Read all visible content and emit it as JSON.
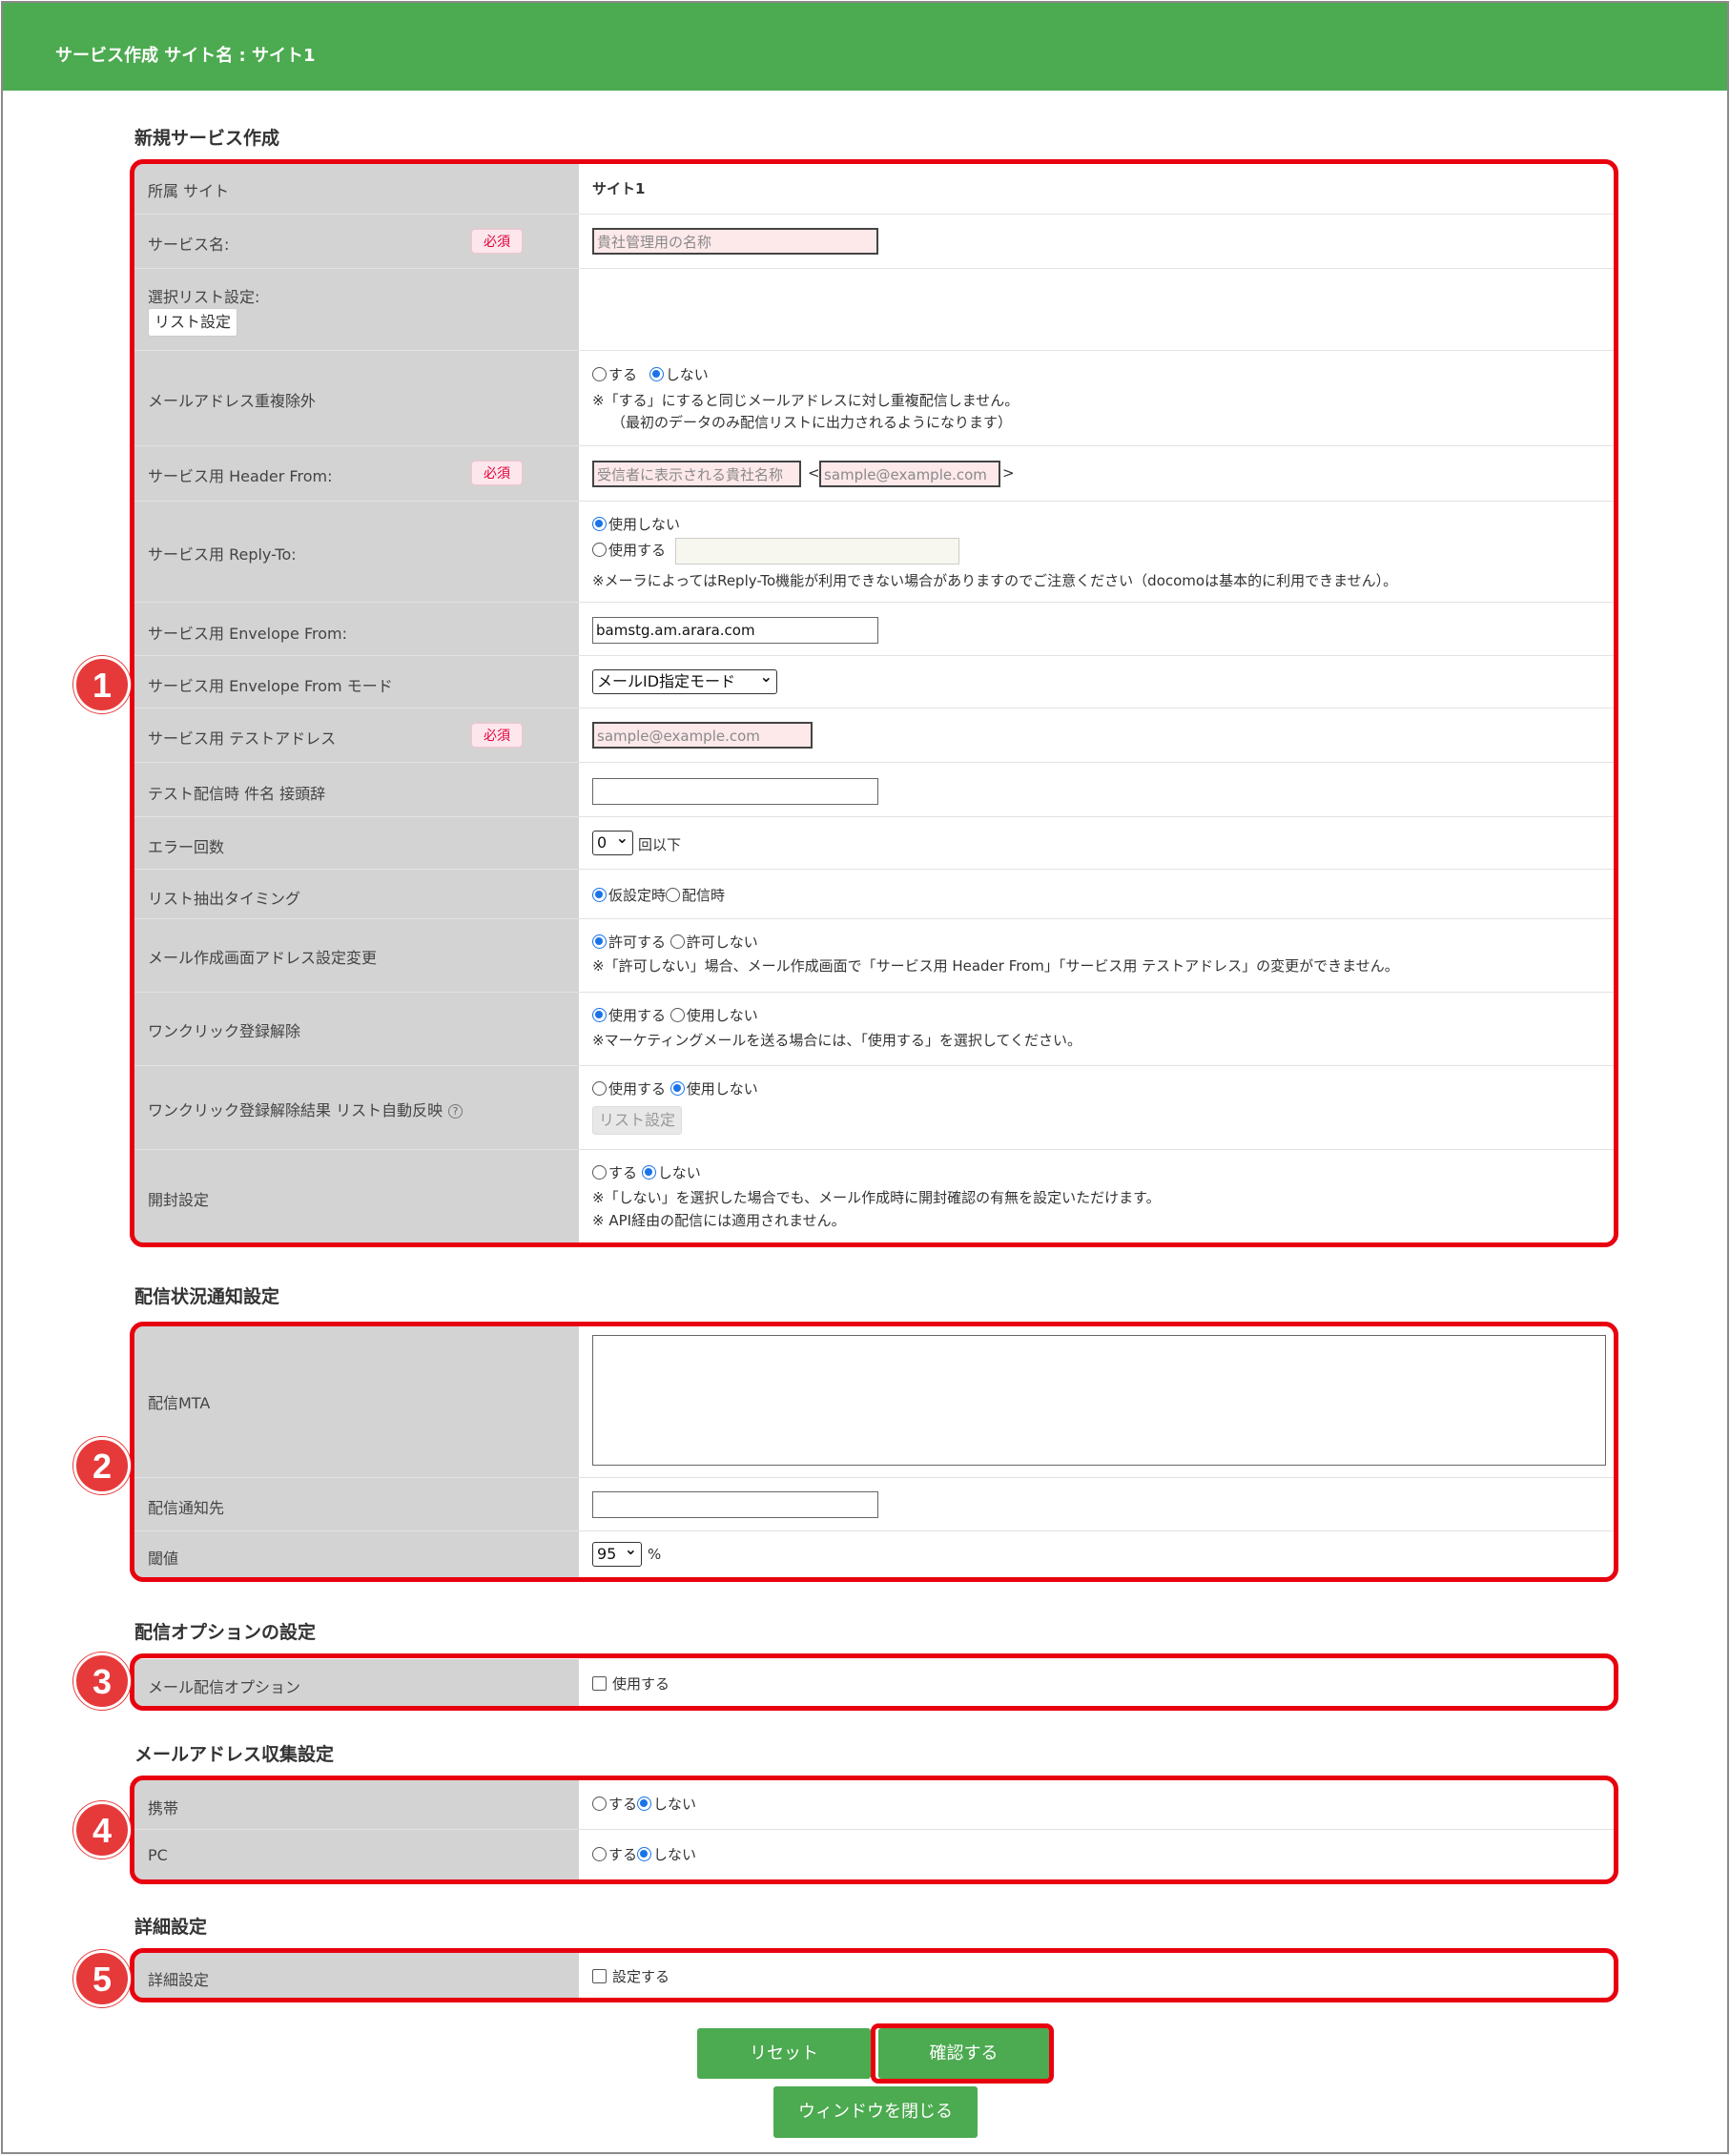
{
  "header": {
    "title": "サービス作成 サイト名 : サイト1"
  },
  "sections": {
    "new_service": "新規サービス作成",
    "delivery_notify": "配信状況通知設定",
    "delivery_option": "配信オプションの設定",
    "address_collect": "メールアドレス収集設定",
    "detail": "詳細設定"
  },
  "required_label": "必須",
  "form": {
    "site": {
      "label": "所属 サイト",
      "value": "サイト1"
    },
    "service_name": {
      "label": "サービス名:",
      "placeholder": "貴社管理用の名称"
    },
    "list_settings": {
      "label": "選択リスト設定:",
      "button": "リスト設定"
    },
    "dedupe": {
      "label": "メールアドレス重複除外",
      "opt_yes": "する",
      "opt_no": "しない",
      "selected": "しない",
      "note1": "※「する」にすると同じメールアドレスに対し重複配信しません。",
      "note2": "（最初のデータのみ配信リストに出力されるようになります）"
    },
    "header_from": {
      "label": "サービス用 Header From:",
      "name_placeholder": "受信者に表示される貴社名称",
      "lt": "<",
      "gt": ">",
      "addr_placeholder": "sample@example.com"
    },
    "reply_to": {
      "label": "サービス用 Reply-To:",
      "opt_off": "使用しない",
      "opt_on": "使用する",
      "selected": "使用しない",
      "note": "※メーラによってはReply-To機能が利用できない場合がありますのでご注意ください（docomoは基本的に利用できません）。"
    },
    "envelope_from": {
      "label": "サービス用 Envelope From:",
      "value": "bamstg.am.arara.com"
    },
    "envelope_mode": {
      "label": "サービス用 Envelope From モード",
      "selected": "メールID指定モード"
    },
    "test_address": {
      "label": "サービス用 テストアドレス",
      "placeholder": "sample@example.com"
    },
    "test_prefix": {
      "label": "テスト配信時 件名 接頭辞",
      "value": ""
    },
    "error_count": {
      "label": "エラー回数",
      "selected": "0",
      "suffix": "回以下"
    },
    "extract_timing": {
      "label": "リスト抽出タイミング",
      "opt_a": "仮設定時",
      "opt_b": "配信時",
      "selected": "仮設定時"
    },
    "address_change": {
      "label": "メール作成画面アドレス設定変更",
      "opt_a": "許可する",
      "opt_b": "許可しない",
      "selected": "許可する",
      "note": "※「許可しない」場合、メール作成画面で「サービス用 Header From」「サービス用 テストアドレス」の変更ができません。"
    },
    "one_click": {
      "label": "ワンクリック登録解除",
      "opt_a": "使用する",
      "opt_b": "使用しない",
      "selected": "使用する",
      "note": "※マーケティングメールを送る場合には、「使用する」を選択してください。"
    },
    "one_click_result": {
      "label": "ワンクリック登録解除結果 リスト自動反映",
      "help": "?",
      "opt_a": "使用する",
      "opt_b": "使用しない",
      "selected": "使用しない",
      "button": "リスト設定"
    },
    "open_tracking": {
      "label": "開封設定",
      "opt_a": "する",
      "opt_b": "しない",
      "selected": "しない",
      "note1": "※「しない」を選択した場合でも、メール作成時に開封確認の有無を設定いただけます。",
      "note2": "※ API経由の配信には適用されません。"
    },
    "mta": {
      "label": "配信MTA",
      "value": ""
    },
    "notify_to": {
      "label": "配信通知先",
      "value": ""
    },
    "threshold": {
      "label": "閾値",
      "selected": "95",
      "suffix": "%"
    },
    "mail_option": {
      "label": "メール配信オプション",
      "checkbox": "使用する"
    },
    "mobile": {
      "label": "携帯",
      "opt_a": "する",
      "opt_b": "しない",
      "selected": "しない"
    },
    "pc": {
      "label": "PC",
      "opt_a": "する",
      "opt_b": "しない",
      "selected": "しない"
    },
    "detail": {
      "label": "詳細設定",
      "checkbox": "設定する"
    }
  },
  "buttons": {
    "reset": "リセット",
    "confirm": "確認する",
    "close": "ウィンドウを閉じる"
  },
  "callouts": [
    "1",
    "2",
    "3",
    "4",
    "5"
  ],
  "colors": {
    "header_bg": "#4caa50",
    "highlight": "#e8000f",
    "badge": "#e63a3a"
  }
}
